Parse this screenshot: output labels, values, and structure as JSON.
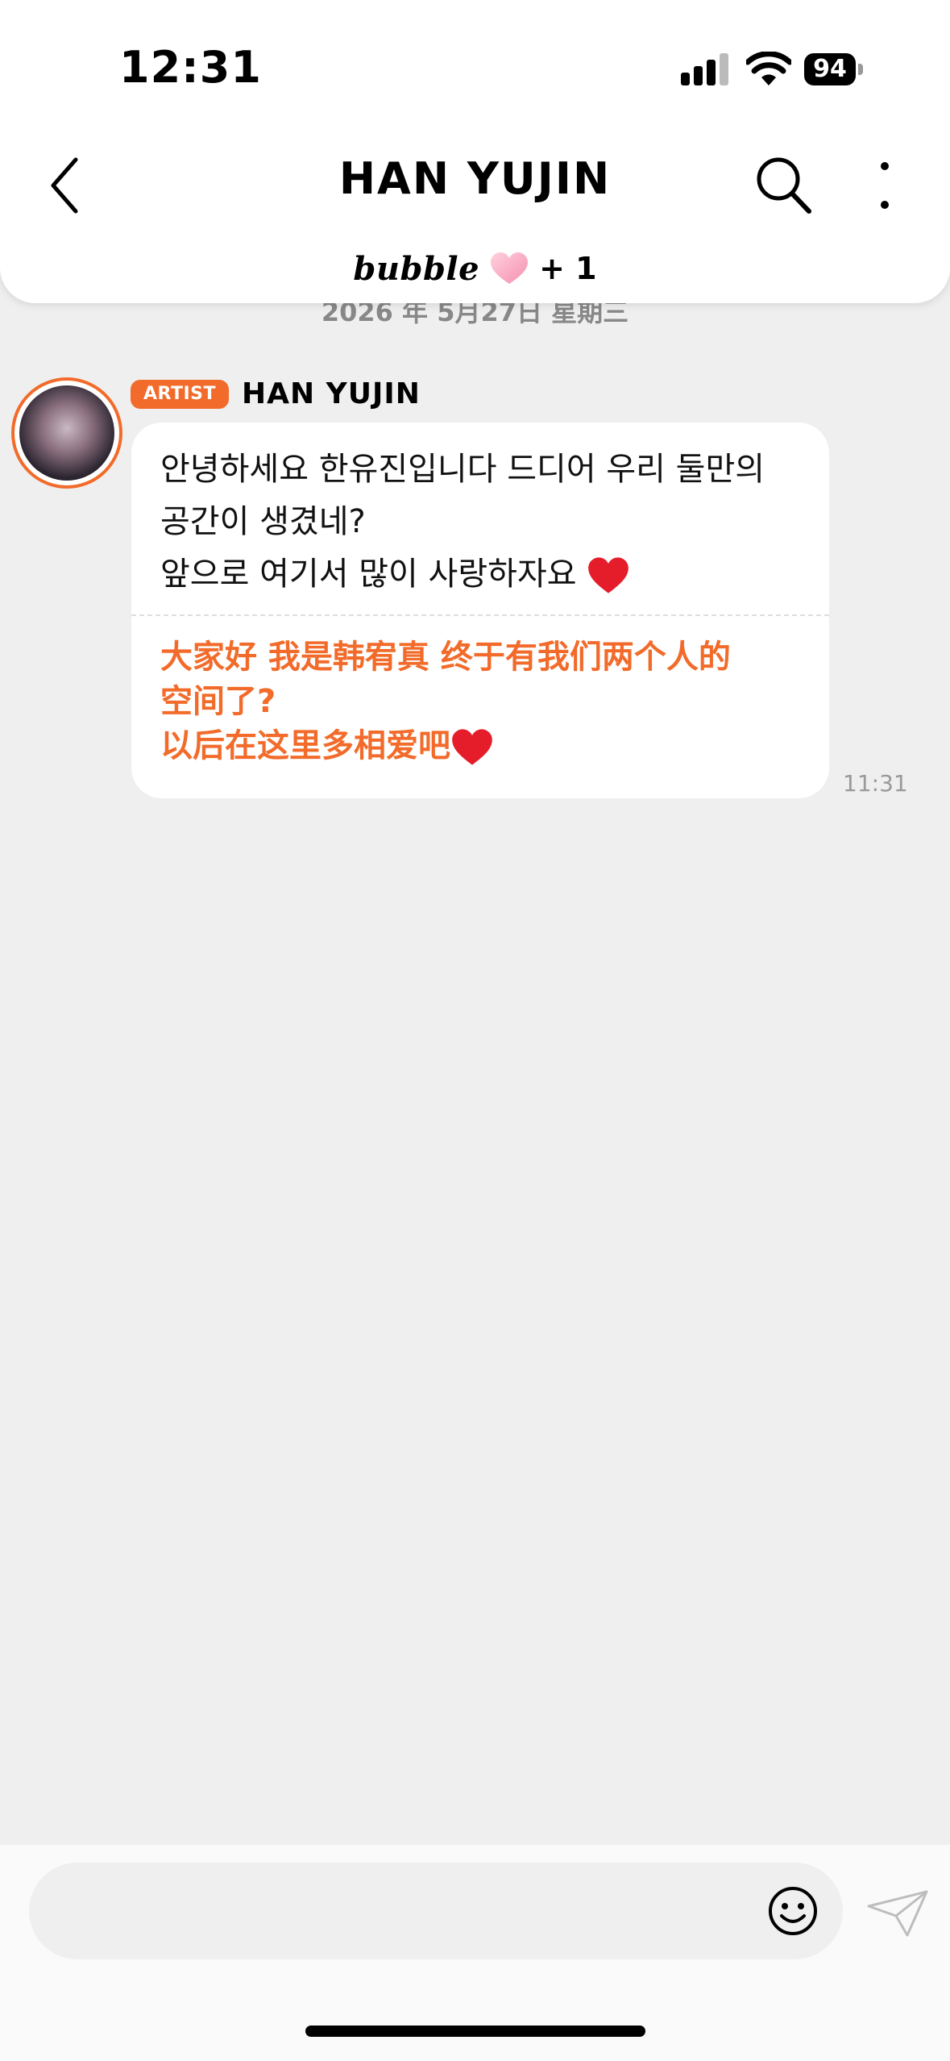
{
  "status_bar": {
    "time": "12:31",
    "battery": "94"
  },
  "header": {
    "title": "HAN YUJIN",
    "subbar_logo": "bubble",
    "subbar_count": "+ 1"
  },
  "chat": {
    "date_separator": "2026 年 5月27日 星期三",
    "messages": [
      {
        "badge": "ARTIST",
        "sender": "HAN YUJIN",
        "text_ko": "안녕하세요 한유진입니다 드디어 우리 둘만의\n공간이 생겼네?\n앞으로 여기서 많이 사랑하자요",
        "text_zh": "大家好 我是韩宥真 终于有我们两个人的\n空间了?\n以后在这里多相爱吧",
        "time": "11:31"
      }
    ]
  },
  "composer": {
    "placeholder": ""
  },
  "colors": {
    "accent": "#f26b2a",
    "background": "#efefef",
    "bubble": "#ffffff"
  },
  "icons": [
    "back-icon",
    "search-icon",
    "more-icon",
    "heart-icon",
    "emoji-icon",
    "send-icon"
  ]
}
